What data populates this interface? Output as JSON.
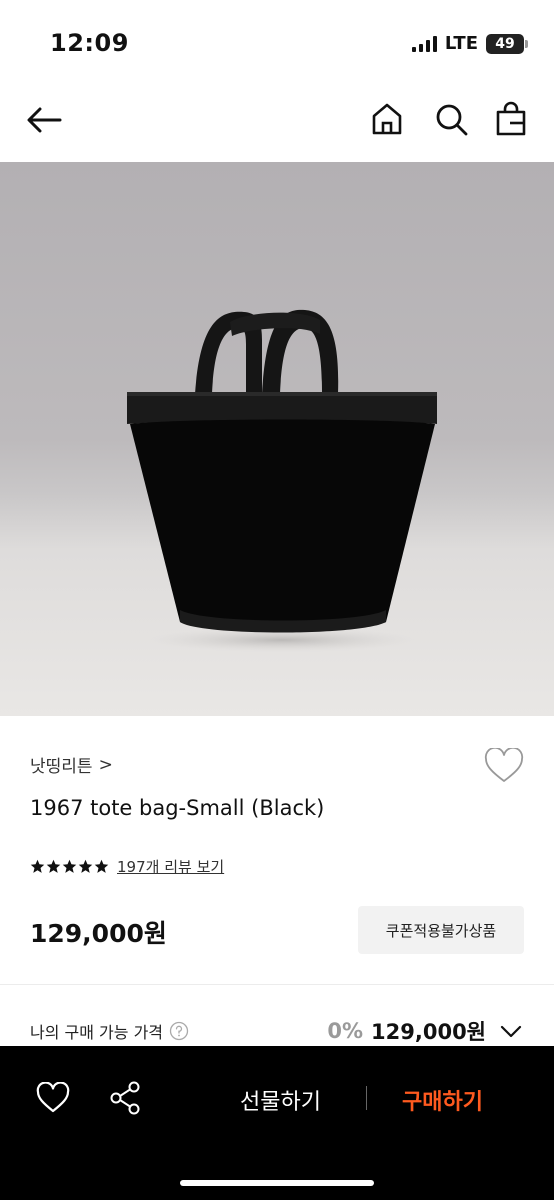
{
  "status_bar": {
    "time": "12:09",
    "network": "LTE",
    "battery": "49"
  },
  "nav": {
    "back_icon": "arrow-left-icon",
    "home_icon": "home-icon",
    "search_icon": "search-icon",
    "bag_icon": "shopping-bag-icon"
  },
  "product": {
    "brand": "낫띵리튼",
    "brand_chevron": ">",
    "title": "1967 tote bag-Small (Black)",
    "rating_stars": 5,
    "review_link": "197개 리뷰 보기",
    "price": "129,000원",
    "coupon_label": "쿠폰적용불가상품"
  },
  "my_price": {
    "label": "나의 구매 가능 가격",
    "help_icon": "question-circle-icon",
    "discount": "0%",
    "value": "129,000원"
  },
  "bottom_bar": {
    "gift_label": "선물하기",
    "buy_label": "구매하기",
    "buy_color": "#ff5a1f"
  },
  "colors": {
    "accent": "#ff5a1f"
  }
}
